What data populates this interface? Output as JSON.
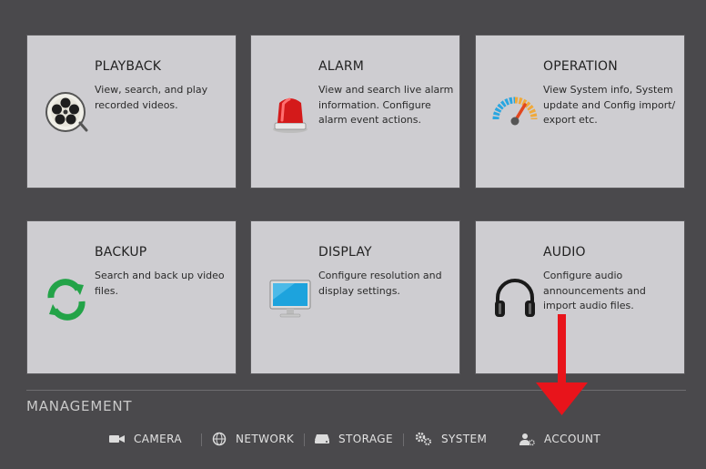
{
  "tiles": [
    {
      "title": "PLAYBACK",
      "desc": "View, search, and play recorded videos.",
      "icon": "film-reel-icon"
    },
    {
      "title": "ALARM",
      "desc": "View and search live alarm information. Configure alarm event actions.",
      "icon": "siren-icon"
    },
    {
      "title": "OPERATION",
      "desc": "View System info, System update and Config import/ export etc.",
      "icon": "gauge-icon"
    },
    {
      "title": "BACKUP",
      "desc": "Search and back up video files.",
      "icon": "sync-icon"
    },
    {
      "title": "DISPLAY",
      "desc": "Configure resolution and display settings.",
      "icon": "monitor-icon"
    },
    {
      "title": "AUDIO",
      "desc": "Configure audio announcements and import audio files.",
      "icon": "headphones-icon"
    }
  ],
  "management": {
    "title": "MANAGEMENT",
    "items": [
      {
        "label": "CAMERA",
        "icon": "camera-icon"
      },
      {
        "label": "NETWORK",
        "icon": "globe-icon"
      },
      {
        "label": "STORAGE",
        "icon": "hdd-icon"
      },
      {
        "label": "SYSTEM",
        "icon": "gears-icon"
      },
      {
        "label": "ACCOUNT",
        "icon": "user-gear-icon"
      }
    ]
  },
  "colors": {
    "background": "#4a494c",
    "tile": "#cecdd1",
    "annotation_arrow": "#e8141b"
  }
}
